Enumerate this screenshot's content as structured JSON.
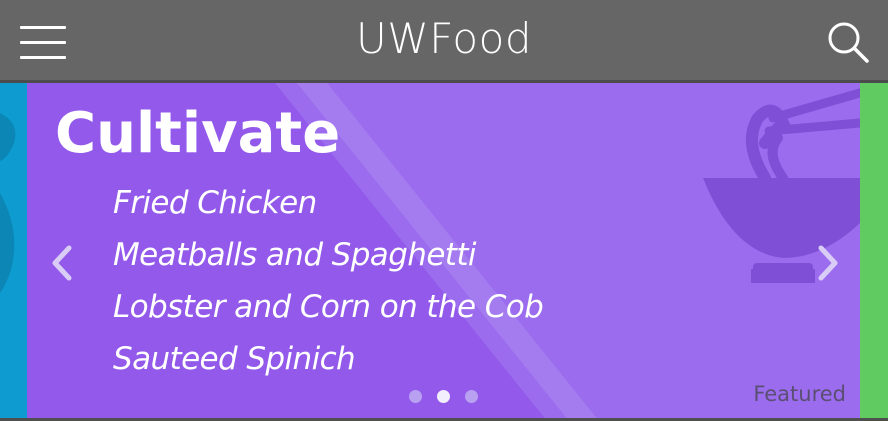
{
  "header": {
    "title": "UWFood",
    "menu_icon": "hamburger-menu-icon",
    "search_icon": "search-icon"
  },
  "carousel": {
    "slide": {
      "name": "Cultivate",
      "items": [
        "Fried Chicken",
        "Meatballs and Spaghetti",
        "Lobster and Corn on the Cob",
        "Sauteed Spinich"
      ],
      "tag": "Featured",
      "illustration_icon": "noodle-bowl-chopsticks-icon"
    },
    "prev_icon": "chevron-left-icon",
    "next_icon": "chevron-right-icon",
    "slide_count": 3,
    "active_slide": 2
  },
  "colors": {
    "header": "#666666",
    "slide": "#9a6ced",
    "left_peek": "#0d9bd0",
    "right_peek": "#5fcb60"
  }
}
